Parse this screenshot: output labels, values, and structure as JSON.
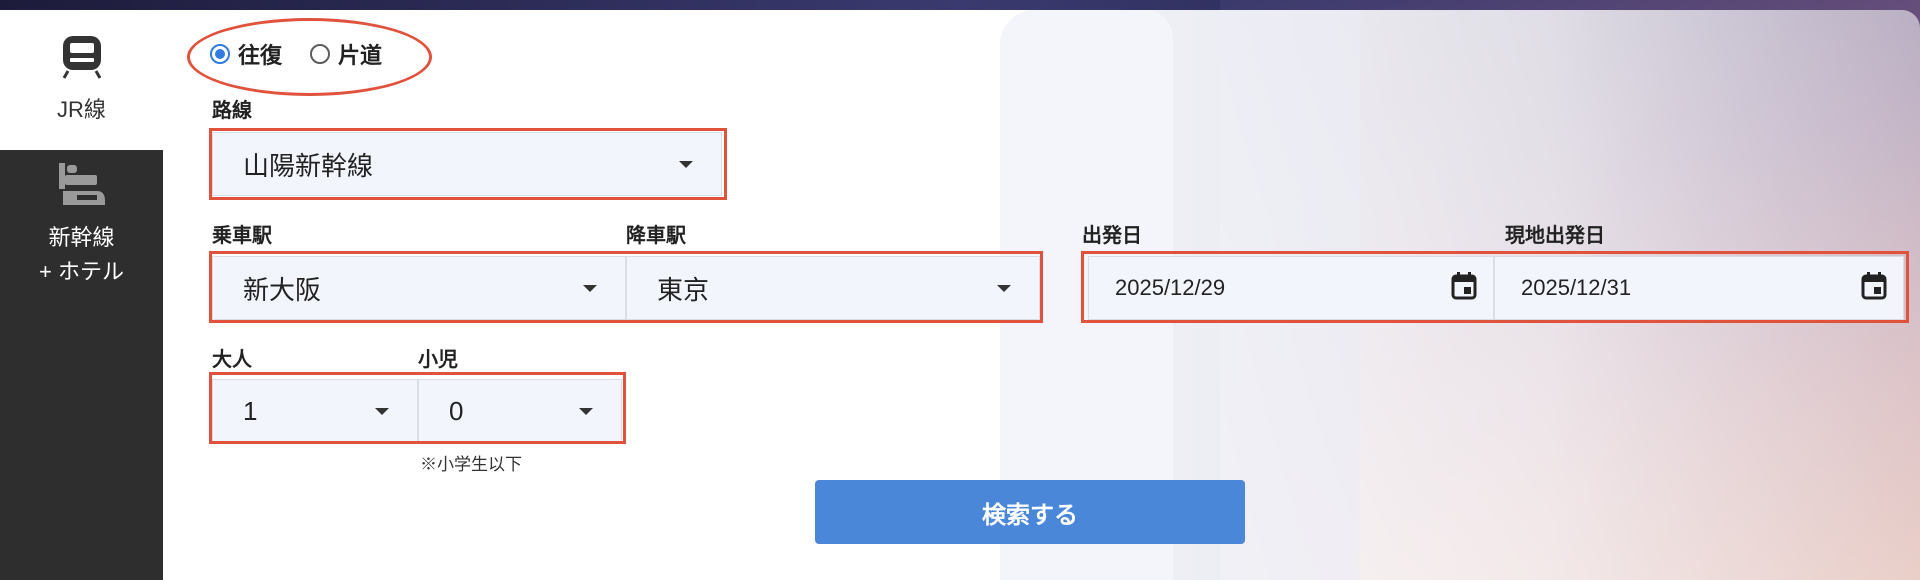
{
  "sidebar": {
    "items": [
      {
        "label": "JR線",
        "icon": "train-icon",
        "active": true
      },
      {
        "label_line1": "新幹線",
        "label_line2": "+ ホテル",
        "icon": "bed-train-icon",
        "active": false
      }
    ]
  },
  "trip_type": {
    "options": [
      {
        "label": "往復",
        "checked": true
      },
      {
        "label": "片道",
        "checked": false
      }
    ]
  },
  "route": {
    "label": "路線",
    "value": "山陽新幹線"
  },
  "departure_station": {
    "label": "乗車駅",
    "value": "新大阪"
  },
  "arrival_station": {
    "label": "降車駅",
    "value": "東京"
  },
  "departure_date": {
    "label": "出発日",
    "value": "2025/12/29"
  },
  "local_departure_date": {
    "label": "現地出発日",
    "value": "2025/12/31"
  },
  "adults": {
    "label": "大人",
    "value": "1"
  },
  "children": {
    "label": "小児",
    "value": "0",
    "note": "※小学生以下"
  },
  "search_button": {
    "label": "検索する"
  },
  "colors": {
    "accent": "#4a87d8",
    "highlight": "#e0523c",
    "sidebar": "#2e2e2e",
    "radio": "#2f7be0"
  }
}
